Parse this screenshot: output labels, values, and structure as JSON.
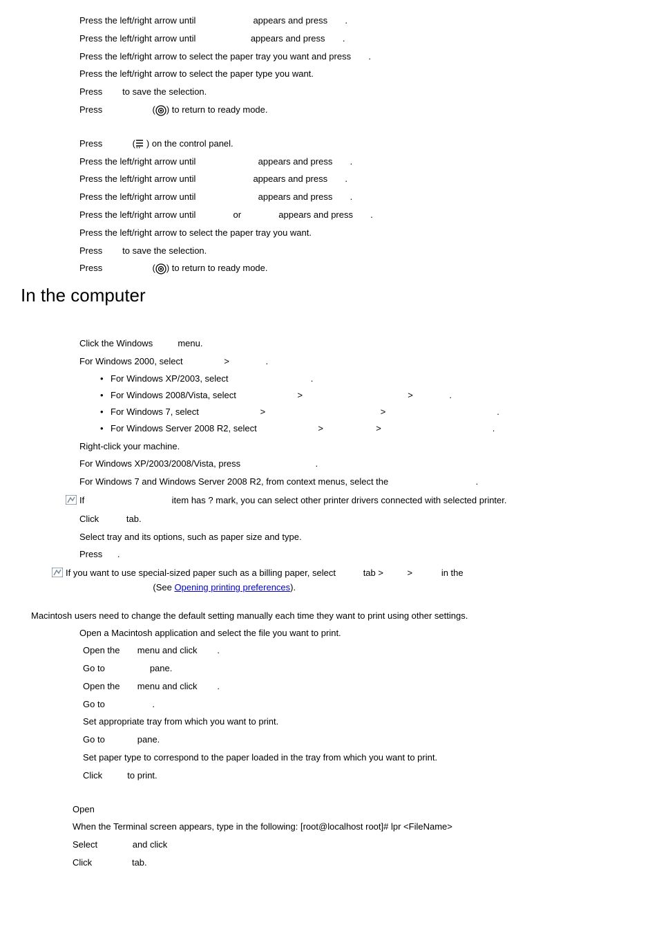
{
  "section1": {
    "s1": {
      "a": "Press the left/right arrow until",
      "b": "appears and press",
      "c": "."
    },
    "s2": {
      "a": "Press the left/right arrow until",
      "b": "appears and press",
      "c": "."
    },
    "s3": {
      "a": "Press the left/right arrow to select the paper tray you want and press",
      "b": "."
    },
    "s4": "Press the left/right arrow to select the paper type you want.",
    "s5": {
      "a": "Press",
      "b": "to save the selection."
    },
    "s6": {
      "a": "Press",
      "b": ") to return to ready mode."
    }
  },
  "section2": {
    "s1": {
      "a": "Press",
      "b": ") on the control panel."
    },
    "s2": {
      "a": "Press the left/right arrow until",
      "b": "appears and press",
      "c": "."
    },
    "s3": {
      "a": "Press the left/right arrow until",
      "b": "appears and press",
      "c": "."
    },
    "s4": {
      "a": "Press the left/right arrow until",
      "b": "appears and press",
      "c": "."
    },
    "s5": {
      "a": "Press the left/right arrow until",
      "b": "or",
      "c": "appears and press",
      "d": "."
    },
    "s6": "Press the left/right arrow to select the paper tray you want.",
    "s7": {
      "a": "Press",
      "b": "to save the selection."
    },
    "s8": {
      "a": "Press",
      "b": ") to return to ready mode."
    }
  },
  "heading": "In the computer",
  "win": {
    "s1": {
      "a": "Click the Windows",
      "b": "menu."
    },
    "s2": {
      "a": "For Windows 2000, select",
      "b": "."
    },
    "b1": {
      "a": "For Windows XP/2003, select",
      "b": "."
    },
    "b2": {
      "a": "For Windows 2008/Vista, select",
      "b": "."
    },
    "b3": {
      "a": "For Windows 7, select",
      "b": "."
    },
    "b4": {
      "a": "For Windows Server 2008 R2, select",
      "b": "."
    },
    "s3": "Right-click your machine.",
    "s4": {
      "a": "For Windows XP/2003/2008/Vista, press",
      "b": "."
    },
    "s5": {
      "a": "For Windows 7 and Windows Server 2008 R2, from context menus, select the",
      "b": "."
    },
    "note1": {
      "a": "If",
      "b": "item has ? mark, you can select other printer drivers connected with selected printer."
    },
    "s6": {
      "a": "Click",
      "b": "tab."
    },
    "s7": "Select tray and its options, such as paper size and type.",
    "s8": {
      "a": "Press",
      "b": "."
    },
    "note2": {
      "a": "If you want to use special-sized paper such as a billing paper, select",
      "b": "tab >",
      "c": "in the",
      "d": "(See ",
      "link": "Opening printing preferences",
      "e": ")."
    }
  },
  "mac": {
    "intro": "Macintosh users need to change the default setting manually each time they want to print using other settings.",
    "s1": "Open a Macintosh application and select the file you want to print.",
    "s2": {
      "a": "Open the",
      "b": "menu and click",
      "c": "."
    },
    "s3": {
      "a": "Go to",
      "b": "pane."
    },
    "s4": {
      "a": "Open the",
      "b": "menu and click",
      "c": "."
    },
    "s5": {
      "a": "Go to",
      "b": "."
    },
    "s6": "Set appropriate tray from which you want to print.",
    "s7": {
      "a": "Go to",
      "b": "pane."
    },
    "s8": "Set paper type to correspond to the paper loaded in the tray from which you want to print.",
    "s9": {
      "a": "Click",
      "b": "to print."
    }
  },
  "linux": {
    "s1": "Open",
    "s2": "When the Terminal screen appears, type in the following: [root@localhost root]# lpr <FileName>",
    "s3": {
      "a": "Select",
      "b": "and click"
    },
    "s4": {
      "a": "Click",
      "b": "tab."
    }
  },
  "gt": ">"
}
